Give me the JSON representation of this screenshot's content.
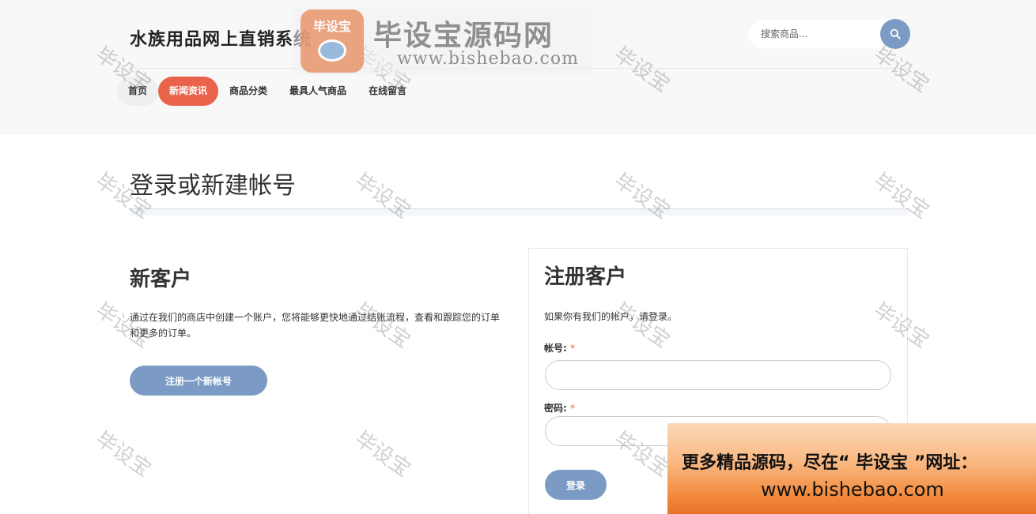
{
  "header": {
    "site_title": "水族用品网上直销系统",
    "search_placeholder": "搜索商品..."
  },
  "nav": {
    "items": [
      "首页",
      "新闻资讯",
      "商品分类",
      "最具人气商品",
      "在线留言"
    ],
    "active_index": 1
  },
  "page": {
    "title": "登录或新建帐号"
  },
  "new_customer": {
    "title": "新客户",
    "description": "通过在我们的商店中创建一个账户，您将能够更快地通过结账流程，查看和跟踪您的订单和更多的订单。",
    "register_button": "注册一个新帐号"
  },
  "login": {
    "title": "注册客户",
    "description": "如果你有我们的帐户，请登录。",
    "account_label": "帐号:",
    "password_label": "密码:",
    "required_mark": "*",
    "account_value": "",
    "password_value": "",
    "login_button": "登录"
  },
  "overlay": {
    "watermark_text": "毕设宝",
    "logo_badge": "毕设宝",
    "logo_name": "毕设宝源码网",
    "logo_url": "www.bishebao.com",
    "promo_line1": "更多精品源码，尽在“ 毕设宝 ”网址：",
    "promo_line2": "www.bishebao.com"
  },
  "colors": {
    "accent": "#e9624a",
    "button": "#7b9bc4",
    "header_bg": "#f8f8f8"
  },
  "icons": {
    "search": "search-icon"
  }
}
